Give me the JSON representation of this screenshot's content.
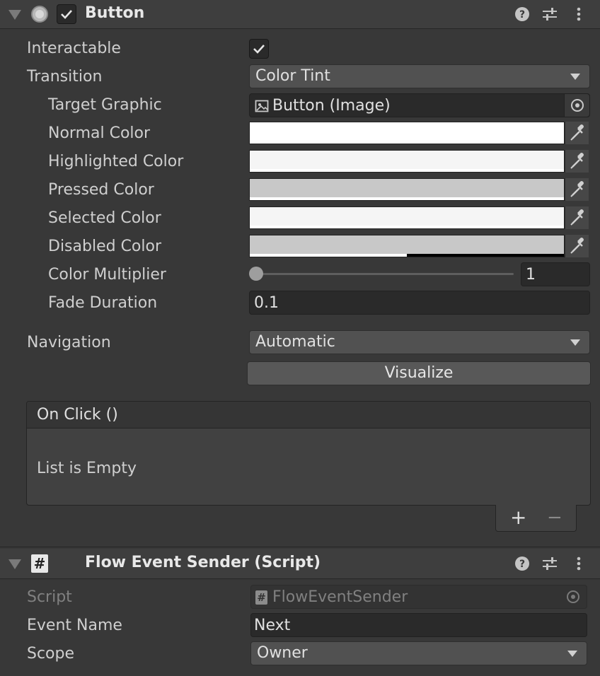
{
  "button_component": {
    "title": "Button",
    "interactable_label": "Interactable",
    "transition_label": "Transition",
    "transition_value": "Color Tint",
    "target_graphic_label": "Target Graphic",
    "target_graphic_value": "Button (Image)",
    "color_rows": [
      {
        "label": "Normal Color",
        "color": "#ffffff",
        "alpha": 1.0
      },
      {
        "label": "Highlighted Color",
        "color": "#f5f5f5",
        "alpha": 1.0
      },
      {
        "label": "Pressed Color",
        "color": "#c8c8c8",
        "alpha": 1.0
      },
      {
        "label": "Selected Color",
        "color": "#f5f5f5",
        "alpha": 1.0
      },
      {
        "label": "Disabled Color",
        "color": "#c8c8c8",
        "alpha": 0.5
      }
    ],
    "color_multiplier_label": "Color Multiplier",
    "color_multiplier_value": "1",
    "fade_duration_label": "Fade Duration",
    "fade_duration_value": "0.1",
    "navigation_label": "Navigation",
    "navigation_value": "Automatic",
    "visualize_label": "Visualize",
    "on_click_label": "On Click ()",
    "list_empty_label": "List is Empty",
    "add_label": "+",
    "remove_label": "−"
  },
  "script_component": {
    "title": "Flow Event Sender (Script)",
    "script_label": "Script",
    "script_value": "FlowEventSender",
    "event_name_label": "Event Name",
    "event_name_value": "Next",
    "scope_label": "Scope",
    "scope_value": "Owner"
  },
  "icons": {
    "help": "help-icon",
    "presets": "presets-icon",
    "menu": "kebab-menu-icon"
  },
  "colors": {
    "background": "#383838",
    "header": "#3e3e3e",
    "field": "#2a2a2a",
    "dropdown": "#515151"
  }
}
